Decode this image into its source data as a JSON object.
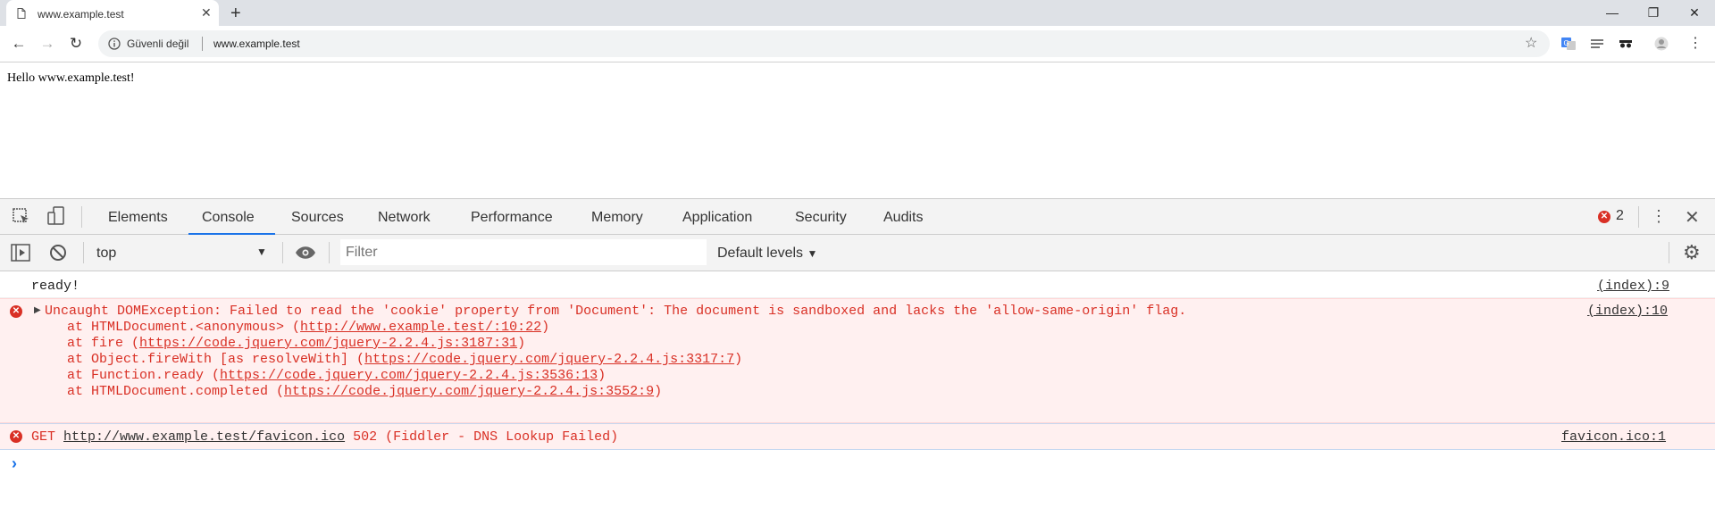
{
  "browser": {
    "tab_title": "www.example.test",
    "new_tab": "+",
    "security_label": "Güvenli değil",
    "url": "www.example.test"
  },
  "page": {
    "text": "Hello www.example.test!"
  },
  "devtools": {
    "tabs": [
      "Elements",
      "Console",
      "Sources",
      "Network",
      "Performance",
      "Memory",
      "Application",
      "Security",
      "Audits"
    ],
    "active_tab": "Console",
    "error_count": "2",
    "context": "top",
    "filter_placeholder": "Filter",
    "levels": "Default levels"
  },
  "console": {
    "messages": [
      {
        "type": "log",
        "text": "ready!",
        "source": "(index):9"
      },
      {
        "type": "error",
        "text": "Uncaught DOMException: Failed to read the 'cookie' property from 'Document': The document is sandboxed and lacks the 'allow-same-origin' flag.",
        "source": "(index):10",
        "stack": [
          {
            "prefix": "at HTMLDocument.<anonymous> (",
            "link": "http://www.example.test/:10:22",
            "suffix": ")"
          },
          {
            "prefix": "at fire (",
            "link": "https://code.jquery.com/jquery-2.2.4.js:3187:31",
            "suffix": ")"
          },
          {
            "prefix": "at Object.fireWith [as resolveWith] (",
            "link": "https://code.jquery.com/jquery-2.2.4.js:3317:7",
            "suffix": ")"
          },
          {
            "prefix": "at Function.ready (",
            "link": "https://code.jquery.com/jquery-2.2.4.js:3536:13",
            "suffix": ")"
          },
          {
            "prefix": "at HTMLDocument.completed (",
            "link": "https://code.jquery.com/jquery-2.2.4.js:3552:9",
            "suffix": ")"
          }
        ]
      },
      {
        "type": "error",
        "method": "GET",
        "url": "http://www.example.test/favicon.ico",
        "status": "502 (Fiddler - DNS Lookup Failed)",
        "source": "favicon.ico:1"
      }
    ],
    "prompt": "›"
  },
  "colors": {
    "error": "#d93025",
    "accent": "#1a73e8"
  }
}
